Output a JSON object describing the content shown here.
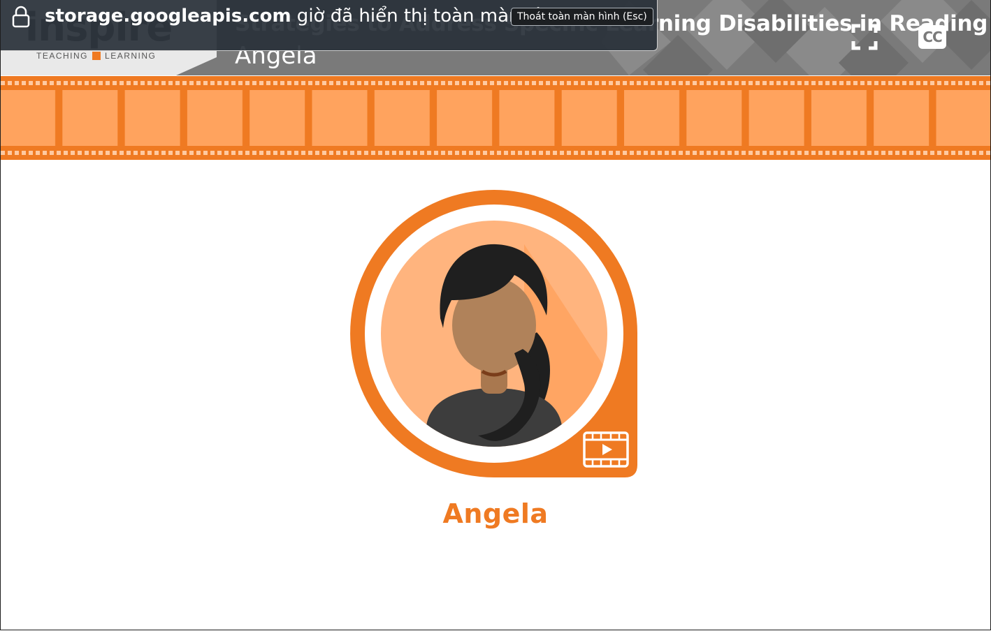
{
  "browser_notice": {
    "domain": "storage.googleapis.com",
    "message": " giờ đã hiển thị toàn màn hình",
    "exit_button": "Thoát toàn màn hình (Esc)"
  },
  "header": {
    "logo_word": "inspire",
    "logo_left": "TEACHING",
    "logo_right": "LEARNING",
    "title": "Strategies to Address Specific Learning Disabilities in Reading",
    "subtitle": "Angela",
    "cc_label": "CC",
    "fullscreen_icon": "fullscreen-icon"
  },
  "main": {
    "character_name": "Angela",
    "video_icon": "video-play-icon"
  },
  "colors": {
    "accent": "#ef7a22",
    "film_frame": "#ffa35e",
    "header_bg": "#7a7a7a",
    "avatar_bg": "#ffb47e"
  }
}
